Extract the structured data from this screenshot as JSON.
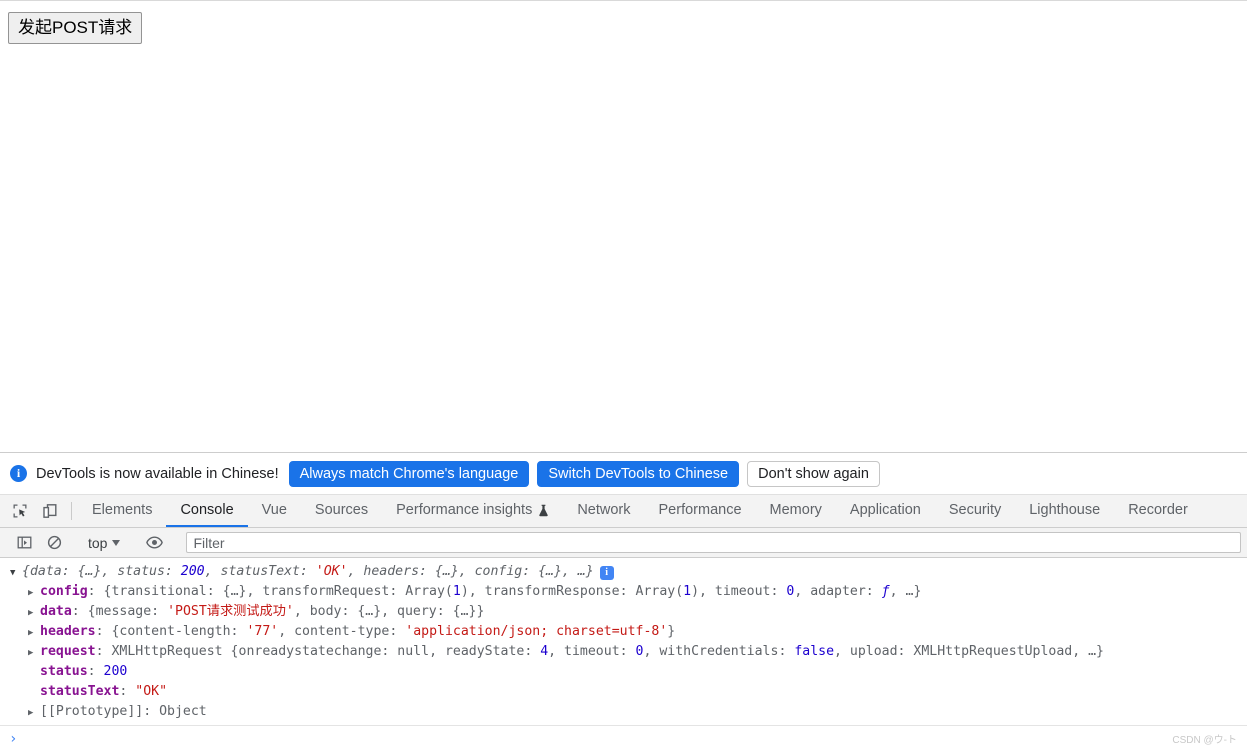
{
  "page": {
    "button_label": "发起POST请求"
  },
  "infobar": {
    "icon": "info-icon",
    "message": "DevTools is now available in Chinese!",
    "buttons": [
      {
        "label": "Always match Chrome's language",
        "style": "primary"
      },
      {
        "label": "Switch DevTools to Chinese",
        "style": "primary"
      },
      {
        "label": "Don't show again",
        "style": "secondary"
      }
    ]
  },
  "devtools": {
    "left_icons": [
      "inspect-element-icon",
      "device-toolbar-icon"
    ],
    "tabs": [
      {
        "label": "Elements",
        "active": false
      },
      {
        "label": "Console",
        "active": true
      },
      {
        "label": "Vue",
        "active": false
      },
      {
        "label": "Sources",
        "active": false
      },
      {
        "label": "Performance insights",
        "active": false,
        "badge": "beaker-icon"
      },
      {
        "label": "Network",
        "active": false
      },
      {
        "label": "Performance",
        "active": false
      },
      {
        "label": "Memory",
        "active": false
      },
      {
        "label": "Application",
        "active": false
      },
      {
        "label": "Security",
        "active": false
      },
      {
        "label": "Lighthouse",
        "active": false
      },
      {
        "label": "Recorder",
        "active": false
      }
    ],
    "console_toolbar": {
      "sidebar_toggle_icon": "console-sidebar-icon",
      "clear_icon": "clear-console-icon",
      "context": "top",
      "eye_icon": "live-expression-icon",
      "filter_placeholder": "Filter",
      "filter_value": ""
    },
    "prompt": {
      "caret": "›",
      "value": ""
    }
  },
  "console_output": {
    "root": {
      "arrow": "▼",
      "text": "{data: {…}, status: 200, statusText: 'OK', headers: {…}, config: {…}, …}",
      "badge": "i"
    },
    "rows": [
      {
        "arrow": "▶",
        "key": "config",
        "key_style": "own",
        "value": "{transitional: {…}, transformRequest: Array(1), transformResponse: Array(1), timeout: 0, adapter: ƒ, …}"
      },
      {
        "arrow": "▶",
        "key": "data",
        "key_style": "own",
        "value": "{message: 'POST请求测试成功', body: {…}, query: {…}}"
      },
      {
        "arrow": "▶",
        "key": "headers",
        "key_style": "own",
        "value": "{content-length: '77', content-type: 'application/json; charset=utf-8'}"
      },
      {
        "arrow": "▶",
        "key": "request",
        "key_style": "own",
        "value": "XMLHttpRequest {onreadystatechange: null, readyState: 4, timeout: 0, withCredentials: false, upload: XMLHttpRequestUpload, …}"
      },
      {
        "arrow": "",
        "key": "status",
        "key_style": "own",
        "value": "200"
      },
      {
        "arrow": "",
        "key": "statusText",
        "key_style": "own",
        "value": "\"OK\""
      },
      {
        "arrow": "▶",
        "key": "[[Prototype]]",
        "key_style": "proto",
        "value": "Object"
      }
    ]
  },
  "watermark": "CSDN @ウ-ト",
  "colors": {
    "accent_blue": "#1a73e8",
    "string_red": "#c41a16",
    "number_blue": "#1c00cf",
    "key_magenta": "#881391"
  }
}
